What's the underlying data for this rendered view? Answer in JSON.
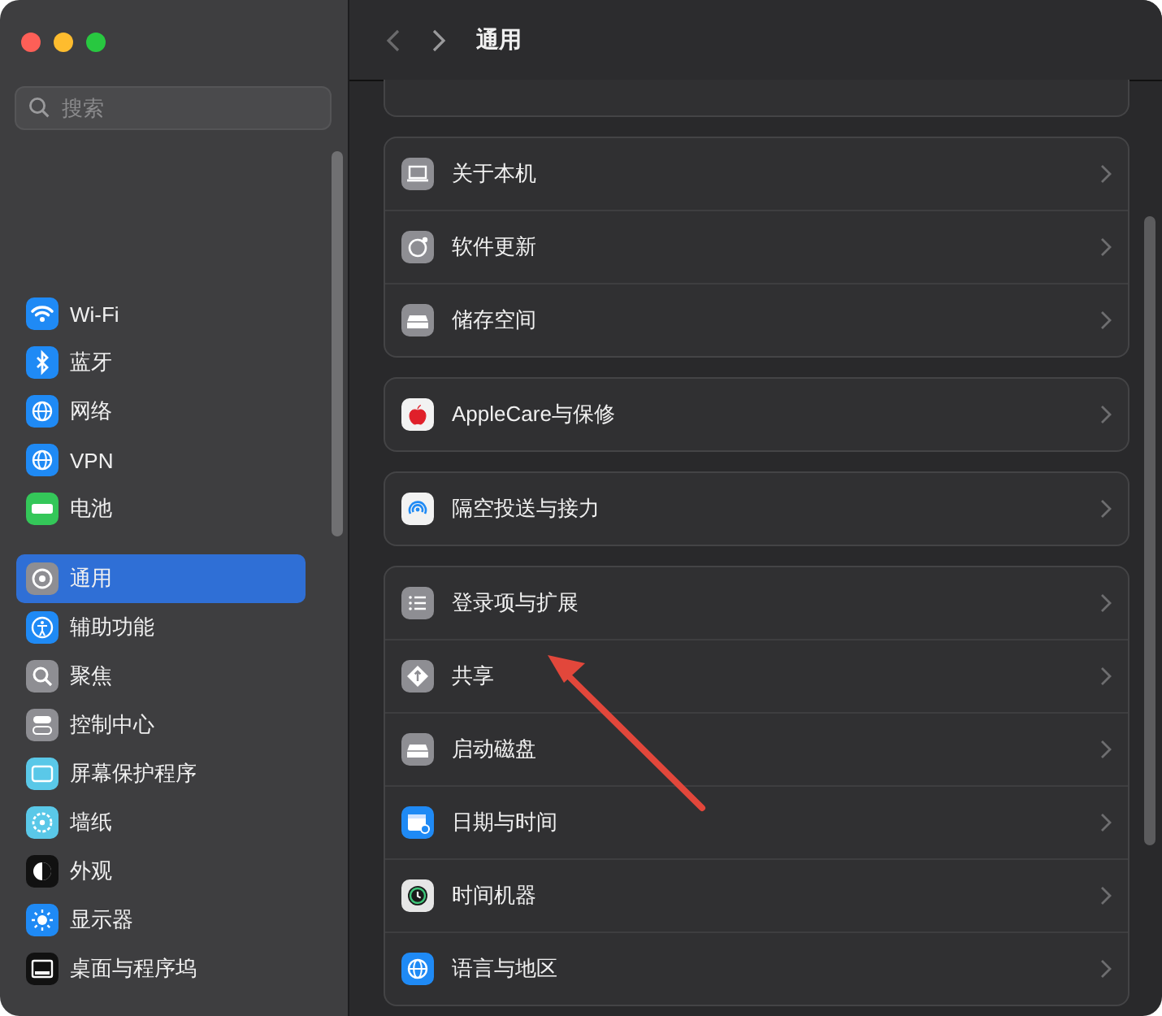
{
  "window": {
    "title": "通用"
  },
  "sidebar": {
    "search": {
      "placeholder": "搜索"
    },
    "sections": [
      {
        "items": [
          {
            "label": "Wi-Fi",
            "color": "#1f8af5",
            "selected": false
          },
          {
            "label": "蓝牙",
            "color": "#1f8af5",
            "selected": false
          },
          {
            "label": "网络",
            "color": "#1f8af5",
            "selected": false
          },
          {
            "label": "VPN",
            "color": "#1f8af5",
            "selected": false
          },
          {
            "label": "电池",
            "color": "#34c759",
            "selected": false
          }
        ]
      },
      {
        "items": [
          {
            "label": "通用",
            "color": "#8e8e93",
            "selected": true
          },
          {
            "label": "辅助功能",
            "color": "#1f8af5",
            "selected": false
          },
          {
            "label": "聚焦",
            "color": "#8e8e93",
            "selected": false
          },
          {
            "label": "控制中心",
            "color": "#8e8e93",
            "selected": false
          },
          {
            "label": "屏幕保护程序",
            "color": "#5ac8e8",
            "selected": false
          },
          {
            "label": "墙纸",
            "color": "#5ac8e8",
            "selected": false
          },
          {
            "label": "外观",
            "color": "#111111",
            "selected": false
          },
          {
            "label": "显示器",
            "color": "#1f8af5",
            "selected": false
          },
          {
            "label": "桌面与程序坞",
            "color": "#111111",
            "selected": false
          }
        ]
      }
    ]
  },
  "main": {
    "groups": [
      {
        "rows": [
          {
            "label": "关于本机",
            "color": "#8e8e93"
          },
          {
            "label": "软件更新",
            "color": "#8e8e93"
          },
          {
            "label": "储存空间",
            "color": "#8e8e93"
          }
        ]
      },
      {
        "rows": [
          {
            "label": "AppleCare与保修",
            "color": "#f2f2f2"
          }
        ]
      },
      {
        "rows": [
          {
            "label": "隔空投送与接力",
            "color": "#f2f2f2"
          }
        ]
      },
      {
        "rows": [
          {
            "label": "登录项与扩展",
            "color": "#8e8e93"
          },
          {
            "label": "共享",
            "color": "#8e8e93"
          },
          {
            "label": "启动磁盘",
            "color": "#8e8e93"
          },
          {
            "label": "日期与时间",
            "color": "#1f8af5"
          },
          {
            "label": "时间机器",
            "color": "#e6e6e6"
          },
          {
            "label": "语言与地区",
            "color": "#1f8af5"
          }
        ]
      }
    ]
  }
}
